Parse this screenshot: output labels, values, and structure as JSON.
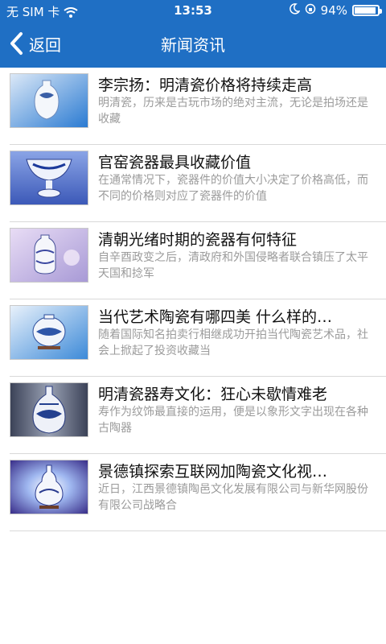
{
  "status_bar": {
    "carrier": "无 SIM 卡",
    "time": "13:53",
    "battery_text": "94%",
    "battery_level": 0.94
  },
  "nav": {
    "back_label": "返回",
    "title": "新闻资讯"
  },
  "news": [
    {
      "title": "李宗扬：明清瓷价格将持续走高",
      "summary": "明清瓷，历来是古玩市场的绝对主流，无论是拍场还是收藏"
    },
    {
      "title": "官窑瓷器最具收藏价值",
      "summary": "在通常情况下，瓷器件的价值大小决定了价格高低，而不同的价格则对应了瓷器件的价值"
    },
    {
      "title": "清朝光绪时期的瓷器有何特征",
      "summary": "自辛酉政变之后，清政府和外国侵略者联合镇压了太平天国和捻军"
    },
    {
      "title": "当代艺术陶瓷有哪四美 什么样的…",
      "summary": "随着国际知名拍卖行相继成功开拍当代陶瓷艺术品，社会上掀起了投资收藏当"
    },
    {
      "title": "明清瓷器寿文化：狂心未歇情难老",
      "summary": "寿作为纹饰最直接的运用，便是以象形文字出现在各种古陶器"
    },
    {
      "title": "景德镇探索互联网加陶瓷文化视…",
      "summary": "近日，江西景德镇陶邑文化发展有限公司与新华网股份有限公司战略合"
    }
  ]
}
